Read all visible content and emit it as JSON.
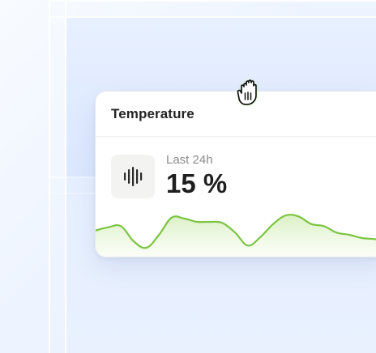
{
  "card": {
    "title": "Temperature",
    "subtitle": "Last 24h",
    "value": "15 %"
  },
  "icons": {
    "metric_icon": "sound-bars-icon",
    "cursor": "grab-hand-icon"
  },
  "chart_data": {
    "type": "area",
    "x": [
      0,
      1,
      2,
      3,
      4,
      5,
      6,
      7,
      8,
      9,
      10,
      11,
      12,
      13,
      14,
      15,
      16,
      17,
      18,
      19,
      20,
      21,
      22,
      23
    ],
    "y": [
      22,
      25,
      26,
      12,
      6,
      18,
      34,
      33,
      30,
      30,
      29,
      20,
      8,
      16,
      28,
      36,
      35,
      28,
      26,
      20,
      18,
      15,
      14,
      12
    ],
    "title": "",
    "xlabel": "",
    "ylabel": "",
    "grid": false,
    "color": "#7cc441",
    "fill_color": "#e8f6d6"
  },
  "colors": {
    "background": "#eef4ff",
    "card": "#ffffff",
    "accent_green": "#7cc441"
  }
}
